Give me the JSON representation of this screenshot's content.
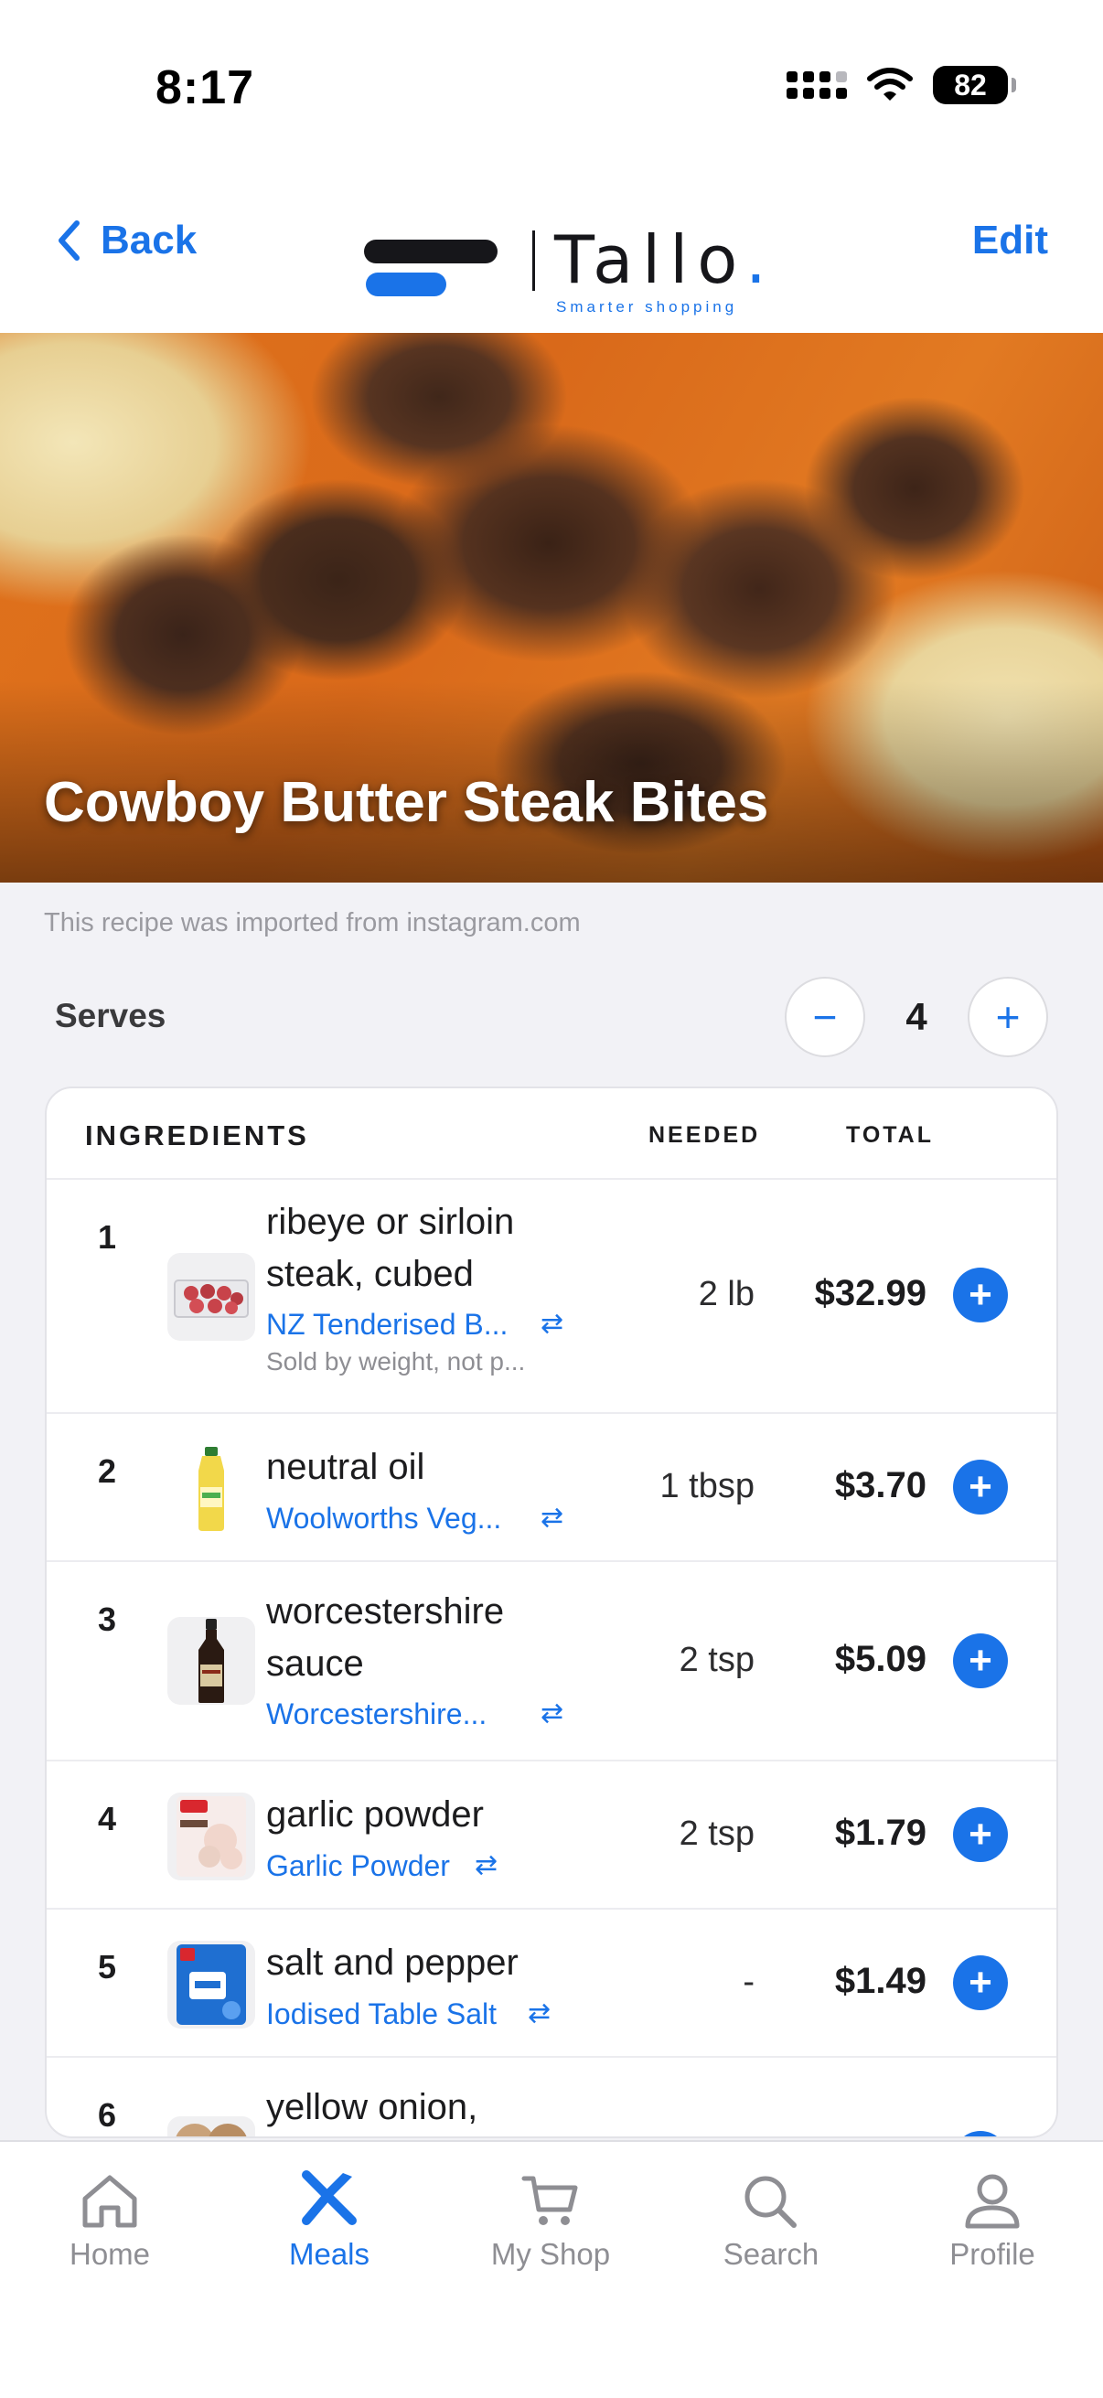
{
  "status": {
    "time": "8:17",
    "battery": "82"
  },
  "header": {
    "back_label": "Back",
    "edit_label": "Edit",
    "logo_word": "Tallo",
    "logo_dot": ".",
    "logo_tagline": "Smarter shopping"
  },
  "recipe": {
    "title": "Cowboy Butter Steak Bites",
    "import_note": "This recipe was imported from instagram.com",
    "serves_label": "Serves",
    "serves_value": "4",
    "minus_symbol": "−",
    "plus_symbol": "+"
  },
  "table": {
    "headers": {
      "ingredients": "INGREDIENTS",
      "needed": "NEEDED",
      "total": "TOTAL"
    },
    "rows": [
      {
        "num": "1",
        "name": "ribeye or sirloin steak, cubed",
        "product": "NZ Tenderised B...",
        "note": "Sold by weight, not p...",
        "needed": "2 lb",
        "total": "$32.99",
        "icon": "steak-pack-icon"
      },
      {
        "num": "2",
        "name": "neutral oil",
        "product": "Woolworths Veg...",
        "note": "",
        "needed": "1 tbsp",
        "total": "$3.70",
        "icon": "oil-bottle-icon"
      },
      {
        "num": "3",
        "name": "worcestershire sauce",
        "product": "Worcestershire...",
        "note": "",
        "needed": "2 tsp",
        "total": "$5.09",
        "icon": "sauce-bottle-icon"
      },
      {
        "num": "4",
        "name": "garlic powder",
        "product": "Garlic Powder",
        "note": "",
        "needed": "2 tsp",
        "total": "$1.79",
        "icon": "garlic-pack-icon"
      },
      {
        "num": "5",
        "name": "salt and pepper",
        "product": "Iodised Table Salt",
        "note": "",
        "needed": "-",
        "total": "$1.49",
        "icon": "salt-pack-icon"
      },
      {
        "num": "6",
        "name": "yellow onion,",
        "product": "",
        "note": "",
        "needed": "",
        "total": "",
        "icon": "onion-icon"
      }
    ],
    "swap_symbol": "⇄",
    "add_symbol": "+"
  },
  "tabbar": {
    "items": [
      {
        "label": "Home",
        "icon": "home-icon",
        "active": false
      },
      {
        "label": "Meals",
        "icon": "fork-knife-icon",
        "active": true
      },
      {
        "label": "My Shop",
        "icon": "cart-icon",
        "active": false
      },
      {
        "label": "Search",
        "icon": "search-icon",
        "active": false
      },
      {
        "label": "Profile",
        "icon": "profile-icon",
        "active": false
      }
    ]
  },
  "colors": {
    "accent": "#1a73e8",
    "background": "#f2f2f6",
    "text": "#1c1c1e",
    "muted": "#8e8e93"
  }
}
